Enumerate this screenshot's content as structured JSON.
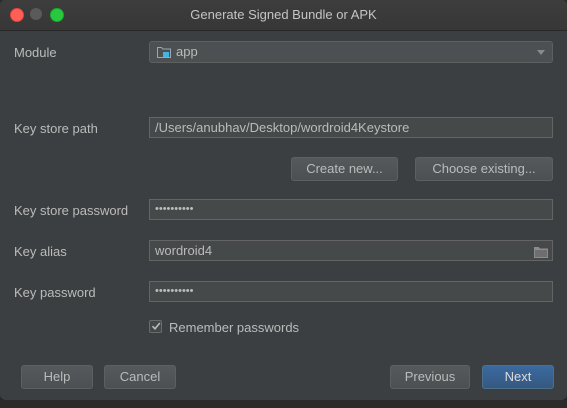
{
  "window": {
    "title": "Generate Signed Bundle or APK"
  },
  "form": {
    "module_label": "Module",
    "module_value": "app",
    "keystore_path_label": "Key store path",
    "keystore_path_value": "/Users/anubhav/Desktop/wordroid4Keystore",
    "create_new_label": "Create new...",
    "choose_existing_label": "Choose existing...",
    "keystore_password_label": "Key store password",
    "keystore_password_value": "••••••••••",
    "key_alias_label": "Key alias",
    "key_alias_value": "wordroid4",
    "key_password_label": "Key password",
    "key_password_value": "••••••••••",
    "remember_label": "Remember passwords",
    "remember_checked": true
  },
  "footer": {
    "help_label": "Help",
    "cancel_label": "Cancel",
    "previous_label": "Previous",
    "next_label": "Next"
  },
  "colors": {
    "accent": "#365880",
    "dialog_bg": "#3c3f41"
  },
  "icons": [
    "folder-icon",
    "chevron-down-icon",
    "browse-folder-icon",
    "checkmark-icon"
  ]
}
